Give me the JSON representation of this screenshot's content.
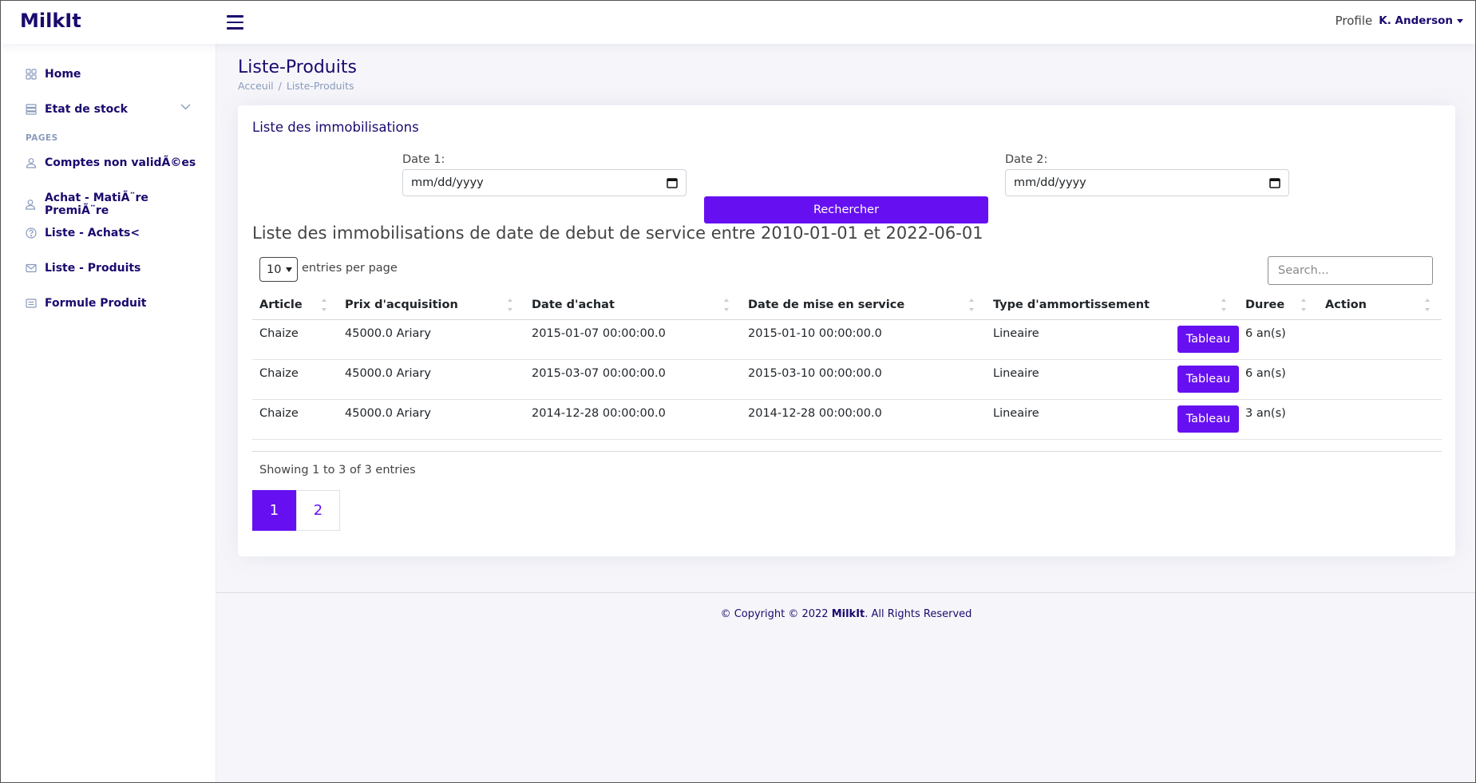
{
  "header": {
    "logo": "MilkIt",
    "profile_alt": "Profile",
    "profile_name": "K. Anderson"
  },
  "sidebar": {
    "items": [
      {
        "label": "Home",
        "icon": "grid-icon"
      },
      {
        "label": "Etat de stock",
        "icon": "stack-icon"
      },
      {
        "label": "Comptes non validÃ©es",
        "icon": "person-icon"
      },
      {
        "label": "Achat - MatiÃ¨re PremiÃ¨re",
        "icon": "person-icon"
      },
      {
        "label": "Liste - Achats<",
        "icon": "question-icon"
      },
      {
        "label": "Liste - Produits",
        "icon": "envelope-icon"
      },
      {
        "label": "Formule Produit",
        "icon": "card-icon"
      }
    ],
    "heading": "PAGES"
  },
  "page": {
    "title": "Liste-Produits",
    "breadcrumb": [
      "Acceuil",
      "/",
      "Liste-Produits"
    ]
  },
  "card": {
    "title": "Liste des immobilisations",
    "date1_label": "Date 1:",
    "date1_placeholder": "mm/dd/yyyy",
    "date2_label": "Date 2:",
    "date2_placeholder": "mm/dd/yyyy",
    "search_button": "Rechercher",
    "subtitle": "Liste des immobilisations de date de debut de service entre 2010-01-01 et 2022-06-01",
    "per_page_value": "10",
    "per_page_label": "entries per page",
    "search_placeholder": "Search...",
    "columns": [
      "Article",
      "Prix d'acquisition",
      "Date d'achat",
      "Date de mise en service",
      "Type d'ammortissement",
      "Duree",
      "Action"
    ],
    "rows": [
      [
        "Chaize",
        "45000.0 Ariary",
        "2015-01-07 00:00:00.0",
        "2015-01-10 00:00:00.0",
        "Lineaire",
        "6 an(s)",
        "Tableau"
      ],
      [
        "Chaize",
        "45000.0 Ariary",
        "2015-03-07 00:00:00.0",
        "2015-03-10 00:00:00.0",
        "Lineaire",
        "6 an(s)",
        "Tableau"
      ],
      [
        "Chaize",
        "45000.0 Ariary",
        "2014-12-28 00:00:00.0",
        "2014-12-28 00:00:00.0",
        "Lineaire",
        "3 an(s)",
        "Tableau"
      ]
    ],
    "showing": "Showing 1 to 3 of 3 entries",
    "pages": [
      "1",
      "2"
    ]
  },
  "footer": {
    "prefix": "© Copyright © 2022 ",
    "brand": "MilkIt",
    "suffix": ". All Rights Reserved"
  },
  "colors": {
    "accent": "#6610f2",
    "brand": "#1a0a6e"
  }
}
